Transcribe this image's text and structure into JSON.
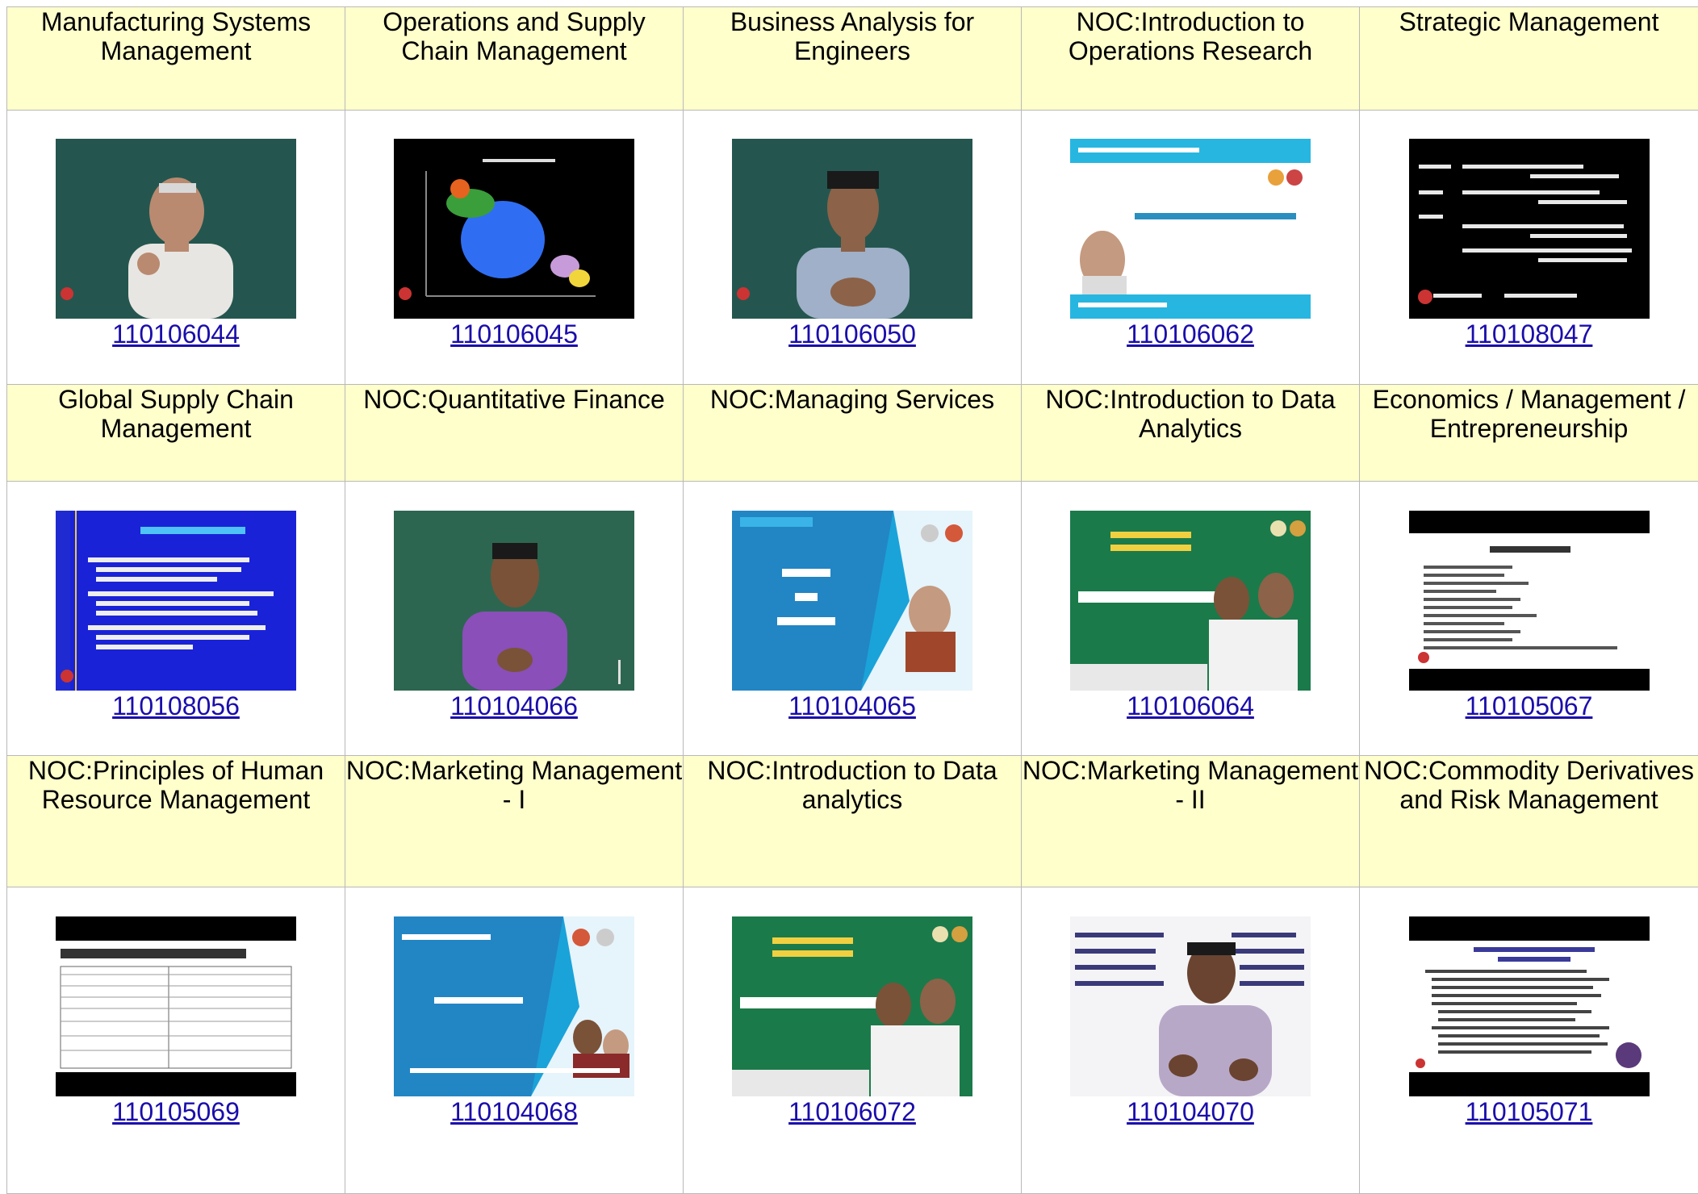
{
  "rows": [
    {
      "courses": [
        {
          "title": "Manufacturing Systems Management",
          "code": "110106044",
          "thumb": "lecturer-video"
        },
        {
          "title": "Operations and Supply Chain Management",
          "code": "110106045",
          "thumb": "bubble-diagram-slide"
        },
        {
          "title": "Business Analysis for Engineers",
          "code": "110106050",
          "thumb": "lecturer-video"
        },
        {
          "title": "NOC:Introduction to Operations Research",
          "code": "110106062",
          "thumb": "title-slide"
        },
        {
          "title": "Strategic Management",
          "code": "110108047",
          "thumb": "text-slide-dark"
        }
      ]
    },
    {
      "courses": [
        {
          "title": "Global Supply Chain Management",
          "code": "110108056",
          "thumb": "blue-text-slide"
        },
        {
          "title": "NOC:Quantitative Finance",
          "code": "110104066",
          "thumb": "lecturer-video"
        },
        {
          "title": "NOC:Managing Services",
          "code": "110104065",
          "thumb": "title-slide"
        },
        {
          "title": "NOC:Introduction to Data Analytics",
          "code": "110106064",
          "thumb": "title-slide-green"
        },
        {
          "title": "Economics / Management / Entrepreneurship",
          "code": "110105067",
          "thumb": "syllabus-slide"
        }
      ]
    },
    {
      "courses": [
        {
          "title": "NOC:Principles of Human Resource Management",
          "code": "110105069",
          "thumb": "table-slide"
        },
        {
          "title": "NOC:Marketing Management - I",
          "code": "110104068",
          "thumb": "title-slide"
        },
        {
          "title": "NOC:Introduction to Data analytics",
          "code": "110106072",
          "thumb": "title-slide-green"
        },
        {
          "title": "NOC:Marketing Management - II",
          "code": "110104070",
          "thumb": "lecturer-video"
        },
        {
          "title": "NOC:Commodity Derivatives and Risk Management",
          "code": "110105071",
          "thumb": "text-slide-light"
        }
      ]
    }
  ],
  "colors": {
    "title_background": "#ffffcc",
    "link": "#1a0dab",
    "border": "#b8b8b8"
  }
}
